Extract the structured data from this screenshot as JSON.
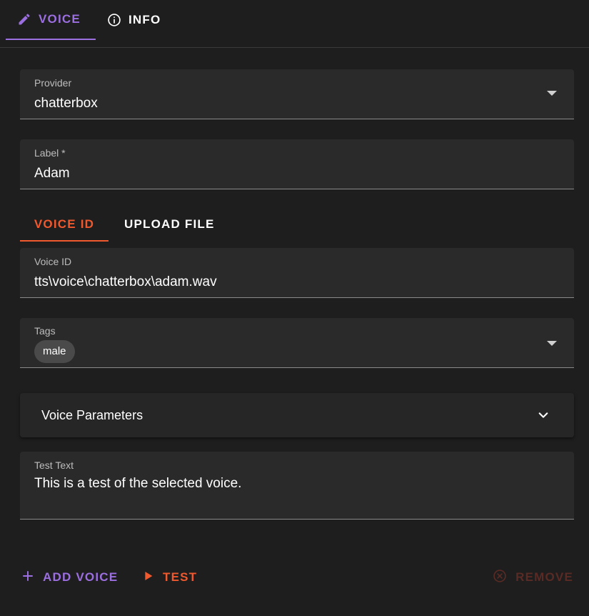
{
  "tabs": {
    "voice_label": "VOICE",
    "info_label": "INFO"
  },
  "provider": {
    "label": "Provider",
    "value": "chatterbox"
  },
  "label_field": {
    "label": "Label *",
    "value": "Adam"
  },
  "source_tabs": {
    "voice_id_label": "VOICE ID",
    "upload_label": "UPLOAD FILE"
  },
  "voice_id": {
    "label": "Voice ID",
    "value": "tts\\voice\\chatterbox\\adam.wav"
  },
  "tags": {
    "label": "Tags",
    "chips": [
      "male"
    ]
  },
  "voice_parameters": {
    "title": "Voice Parameters"
  },
  "test_text": {
    "label": "Test Text",
    "value": "This is a test of the selected voice."
  },
  "actions": {
    "add_voice": "ADD VOICE",
    "test": "TEST",
    "remove": "REMOVE"
  },
  "colors": {
    "accent_purple": "#9c6fe0",
    "accent_orange": "#f0592e",
    "disabled_red": "#5a2a24",
    "background": "#1e1e1e",
    "field_bg": "#2a2a2a"
  },
  "icons": {
    "voice_tab": "pencil-icon",
    "info_tab": "info-icon",
    "add": "plus-icon",
    "test": "play-icon",
    "remove": "remove-circle-icon",
    "dropdown": "caret-down-icon",
    "accordion": "chevron-down-icon"
  }
}
